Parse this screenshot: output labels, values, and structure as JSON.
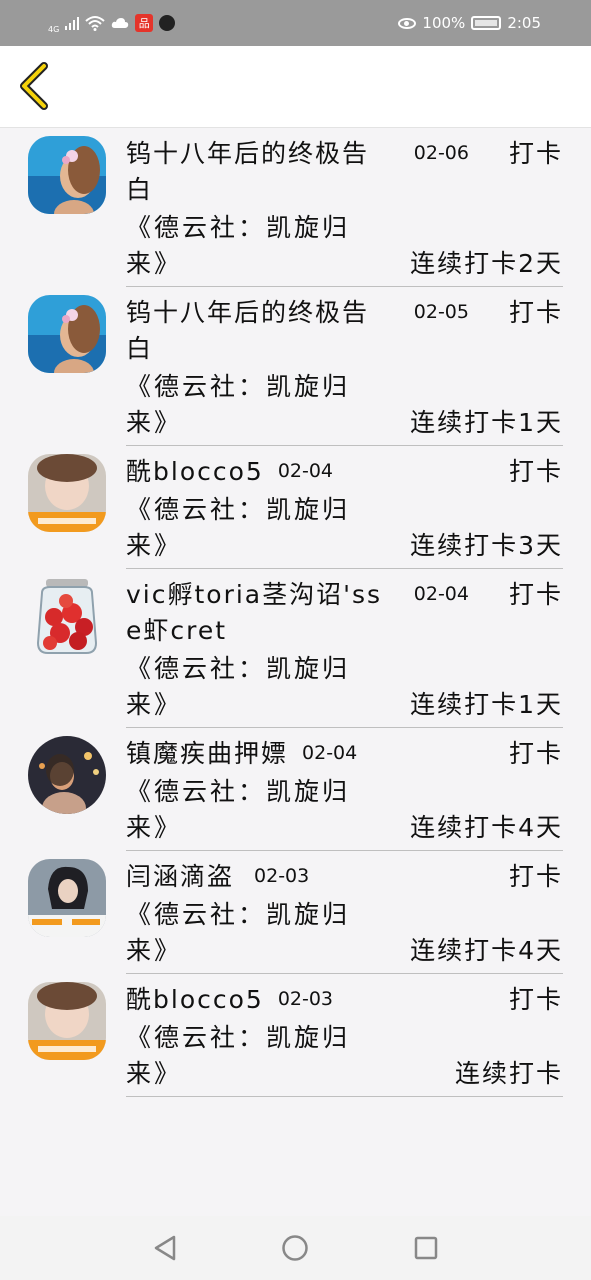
{
  "status_bar": {
    "signal_label": "4G",
    "red_app_glyph": "品",
    "battery_percent": "100%",
    "time": "2:05",
    "icons": [
      "signal-icon",
      "wifi-icon",
      "cloud-icon",
      "app-icon",
      "tiktok-icon",
      "eye-icon",
      "battery-icon"
    ]
  },
  "header": {
    "back_icon": "chevron-left-icon",
    "accent_color": "#f5d20a"
  },
  "records": [
    {
      "name": "钨十八年后的终极告白",
      "date": "02-06",
      "checkin_label": "打卡",
      "book": "《德云社：凯旋归来》",
      "streak": "连续打卡2天",
      "avatar": "avatar-flower-girl"
    },
    {
      "name": "钨十八年后的终极告白",
      "date": "02-05",
      "checkin_label": "打卡",
      "book": "《德云社：凯旋归来》",
      "streak": "连续打卡1天",
      "avatar": "avatar-flower-girl"
    },
    {
      "name": "酰blocco5",
      "date": "02-04",
      "checkin_label": "打卡",
      "book": "《德云社：凯旋归来》",
      "streak": "连续打卡3天",
      "avatar": "avatar-water-girl"
    },
    {
      "name": "vic孵toria茎沟诏'sse虾cret",
      "date": "02-04",
      "checkin_label": "打卡",
      "book": "《德云社：凯旋归来》",
      "streak": "连续打卡1天",
      "avatar": "avatar-strawberry-jar"
    },
    {
      "name": "镇魔疾曲押嫖",
      "date": "02-04",
      "checkin_label": "打卡",
      "book": "《德云社：凯旋归来》",
      "streak": "连续打卡4天",
      "avatar": "avatar-night-girl"
    },
    {
      "name": "闫涵滴盗",
      "date": "02-03",
      "checkin_label": "打卡",
      "book": "《德云社：凯旋归来》",
      "streak": "连续打卡4天",
      "avatar": "avatar-phone-girl"
    },
    {
      "name": "酰blocco5",
      "date": "02-03",
      "checkin_label": "打卡",
      "book": "《德云社：凯旋归来》",
      "streak": "连续打卡",
      "avatar": "avatar-water-girl"
    }
  ],
  "nav_bar": {
    "icons": [
      "back-triangle-icon",
      "home-circle-icon",
      "recents-square-icon"
    ]
  }
}
